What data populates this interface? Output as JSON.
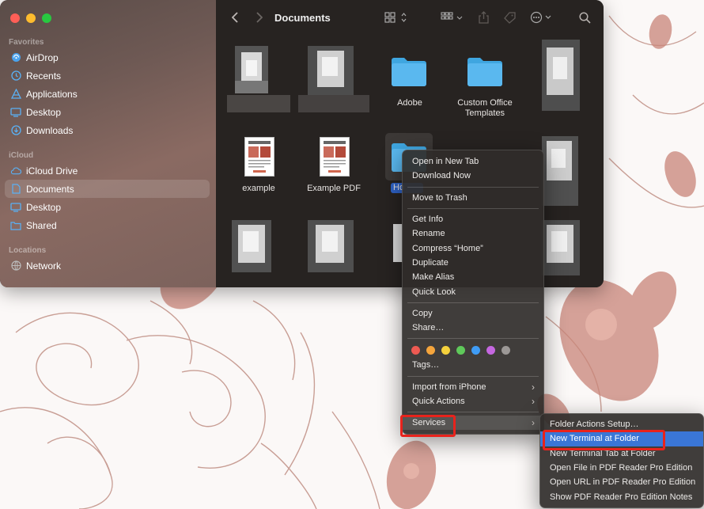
{
  "window": {
    "title": "Documents"
  },
  "sidebar": {
    "favorites_header": "Favorites",
    "icloud_header": "iCloud",
    "locations_header": "Locations",
    "favorites": [
      {
        "label": "AirDrop",
        "icon": "airdrop-icon"
      },
      {
        "label": "Recents",
        "icon": "clock-icon"
      },
      {
        "label": "Applications",
        "icon": "applications-icon"
      },
      {
        "label": "Desktop",
        "icon": "desktop-icon"
      },
      {
        "label": "Downloads",
        "icon": "download-icon"
      }
    ],
    "icloud": [
      {
        "label": "iCloud Drive",
        "icon": "cloud-icon"
      },
      {
        "label": "Documents",
        "icon": "document-icon",
        "selected": true
      },
      {
        "label": "Desktop",
        "icon": "desktop-icon"
      },
      {
        "label": "Shared",
        "icon": "shared-folder-icon"
      }
    ],
    "locations": [
      {
        "label": "Network",
        "icon": "network-icon"
      }
    ]
  },
  "files": {
    "adobe": "Adobe",
    "custom_office_templates_line1": "Custom Office",
    "custom_office_templates_line2": "Templates",
    "example": "example",
    "example_pdf": "Example PDF",
    "home_partial": "Ho"
  },
  "context_menu": {
    "open_new_tab": "Open in New Tab",
    "download_now": "Download Now",
    "move_to_trash": "Move to Trash",
    "get_info": "Get Info",
    "rename": "Rename",
    "compress": "Compress “Home”",
    "duplicate": "Duplicate",
    "make_alias": "Make Alias",
    "quick_look": "Quick Look",
    "copy": "Copy",
    "share": "Share…",
    "tags": "Tags…",
    "import_from_iphone": "Import from iPhone",
    "quick_actions": "Quick Actions",
    "services": "Services",
    "tag_colors": [
      "#ee5a52",
      "#f5a53c",
      "#f5d13c",
      "#5fc95a",
      "#3f9cf5",
      "#c567e0",
      "#9c9896"
    ]
  },
  "services_menu": {
    "items": [
      "Folder Actions Setup…",
      "New Terminal at Folder",
      "New Terminal Tab at Folder",
      "Open File in PDF Reader Pro Edition",
      "Open URL in PDF Reader Pro Edition",
      "Show PDF Reader Pro Edition Notes"
    ],
    "highlighted_index": 1
  },
  "colors": {
    "highlight": "#3a76d6",
    "annotation_box": "#e8231c",
    "folder_blue": "#5ab8ef"
  }
}
